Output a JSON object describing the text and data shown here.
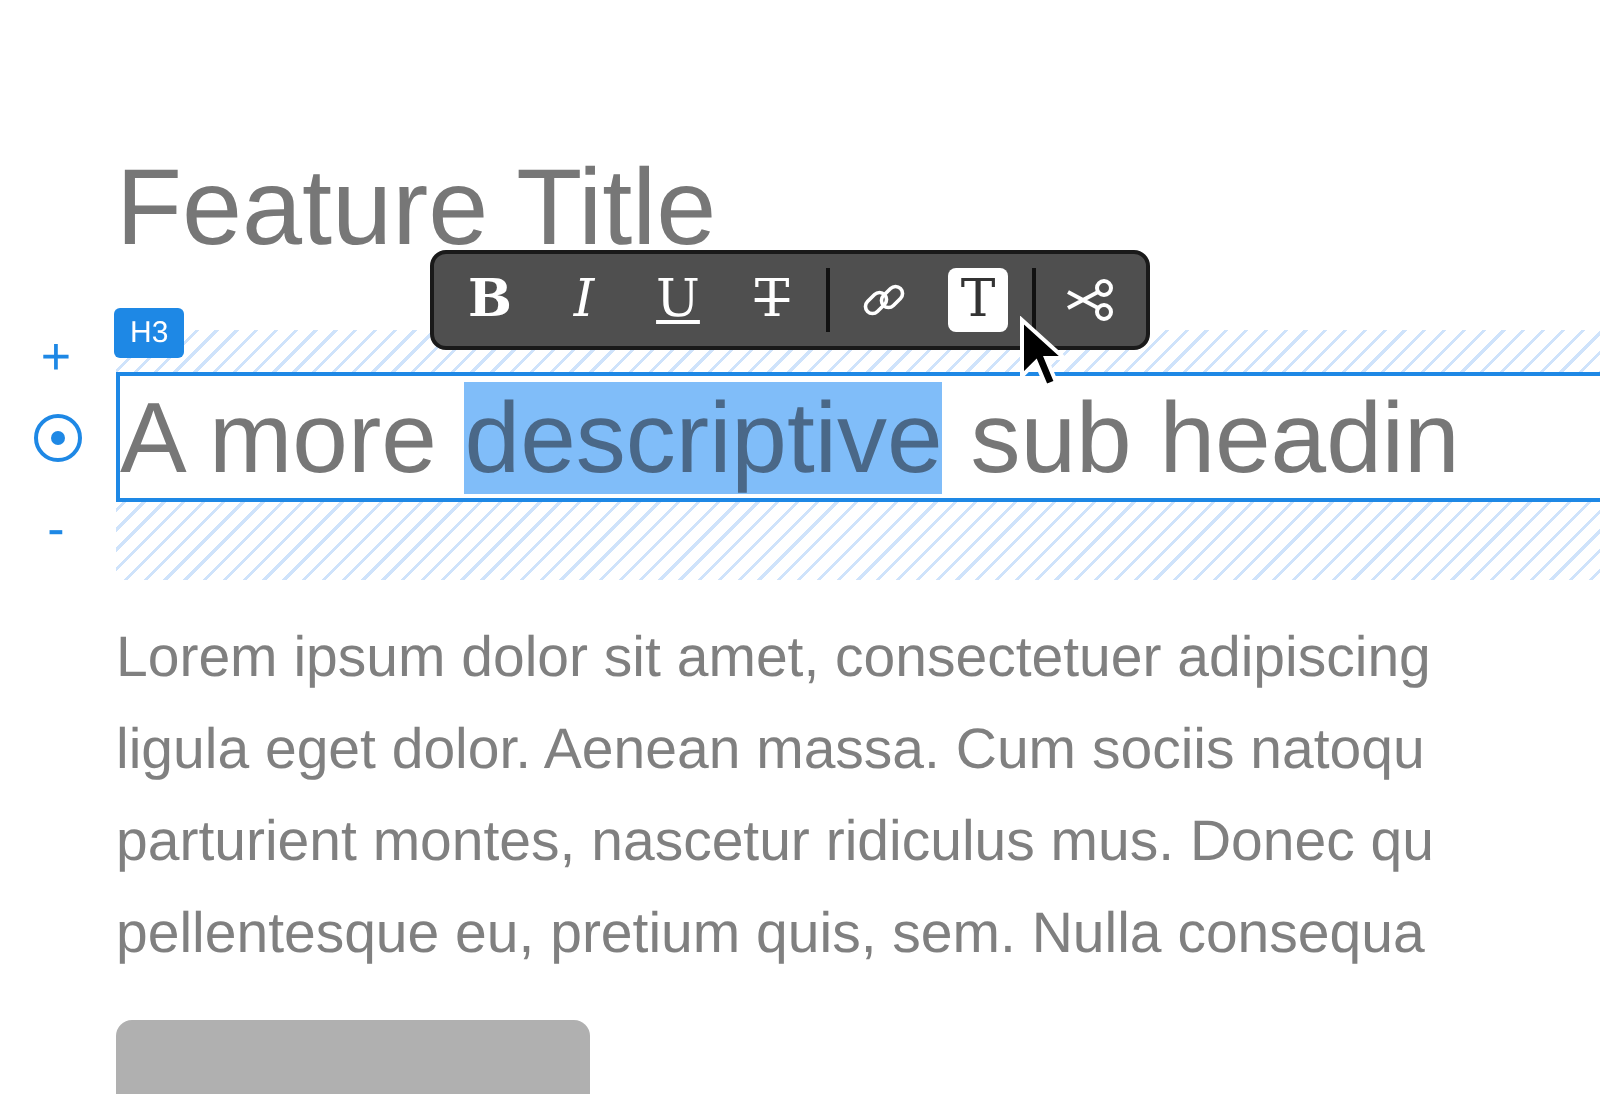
{
  "title": "Feature Title",
  "block": {
    "tag": "H3",
    "controls": {
      "add": "+",
      "remove": "-"
    },
    "heading": [
      {
        "text": "A more ",
        "selected": false
      },
      {
        "text": "descriptive",
        "selected": true
      },
      {
        "text": " sub headin",
        "selected": false
      }
    ]
  },
  "toolbar": [
    {
      "kind": "bold",
      "label": "B",
      "selected": false
    },
    {
      "kind": "italic",
      "label": "I",
      "selected": false
    },
    {
      "kind": "underline",
      "label": "U",
      "selected": false
    },
    {
      "kind": "strike",
      "label": "T",
      "selected": false
    },
    {
      "kind": "divider"
    },
    {
      "kind": "link",
      "selected": false
    },
    {
      "kind": "text",
      "label": "T",
      "selected": true
    },
    {
      "kind": "divider"
    },
    {
      "kind": "cut",
      "selected": false
    }
  ],
  "paragraph": [
    "Lorem ipsum dolor sit amet, consectetuer adipiscing",
    "ligula eget dolor. Aenean massa. Cum sociis natoqu",
    "parturient montes, nascetur ridiculus mus. Donec qu",
    "pellentesque eu, pretium quis, sem. Nulla consequa"
  ]
}
